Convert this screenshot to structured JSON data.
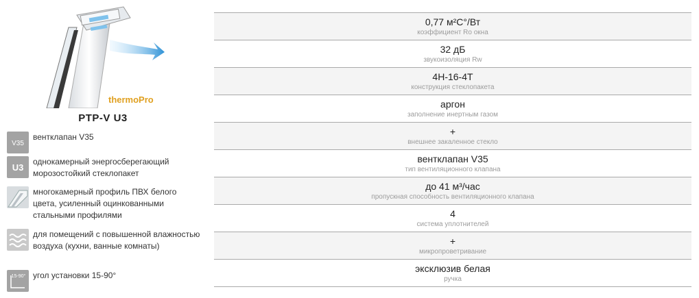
{
  "product": {
    "brand_logo": "thermoPro",
    "name": "PTP-V U3"
  },
  "features": [
    {
      "icon": "v35-badge-icon",
      "badge": "V35",
      "text": "вентклапан V35"
    },
    {
      "icon": "u3-badge-icon",
      "badge": "U3",
      "text": "однокамерный энергосберегающий морозостойкий стеклопакет"
    },
    {
      "icon": "profile-section-icon",
      "badge": "",
      "text": "многокамерный профиль ПВХ белого цвета, усиленный оцинкованными стальными профилями"
    },
    {
      "icon": "humidity-waves-icon",
      "badge": "",
      "text": "для помещений с повышенной влажностью воздуха (кухни, ванные комнаты)"
    },
    {
      "icon": "angle-15-90-icon",
      "badge": "15-90°",
      "text": "угол установки 15-90°"
    }
  ],
  "specs": [
    {
      "value": "0,77 м²С°/Вт",
      "label": "коэффициент Ro окна"
    },
    {
      "value": "32 дБ",
      "label": "звукоизоляция Rw"
    },
    {
      "value": "4Н-16-4Т",
      "label": "конструкция стеклопакета"
    },
    {
      "value": "аргон",
      "label": "заполнение инертным газом"
    },
    {
      "value": "+",
      "label": "внешнее закаленное стекло"
    },
    {
      "value": "вентклапан V35",
      "label": "тип вентиляционного клапана"
    },
    {
      "value": "до 41 м³/час",
      "label": "пропускная способность вентиляционного клапана"
    },
    {
      "value": "4",
      "label": "система уплотнителей"
    },
    {
      "value": "+",
      "label": "микропроветривание"
    },
    {
      "value": "эксклюзив белая",
      "label": "ручка"
    }
  ],
  "colors": {
    "badge_gray": "#9a9a9a",
    "airflow_blue": "#3aa0e0",
    "logo_gold": "#e0a020"
  }
}
